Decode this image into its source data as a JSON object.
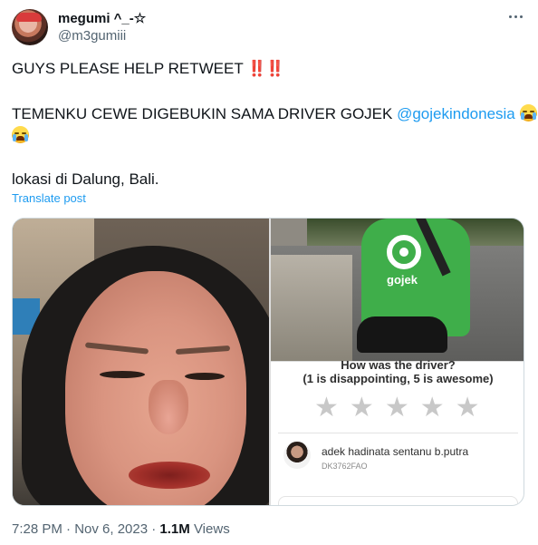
{
  "author": {
    "display_name": "megumi ^_-☆",
    "handle": "@m3gumiii"
  },
  "post": {
    "line1_text": "GUYS PLEASE HELP RETWEET",
    "line1_marks": "‼️‼️",
    "line2_text": "TEMENKU CEWE DIGEBUKIN SAMA DRIVER GOJEK ",
    "mention": "@gojekindonesia",
    "emoji_name": "loudly-crying-face-emoji",
    "line3_text": "lokasi di Dalung, Bali.",
    "translate_label": "Translate post"
  },
  "media": {
    "driver_photo_logo_text": "gojek",
    "rating_panel": {
      "question": "How was the driver?",
      "hint": "(1 is disappointing, 5 is awesome)",
      "stars": [
        "★",
        "★",
        "★",
        "★",
        "★"
      ],
      "star_rating": 0,
      "driver_name": "adek hadinata sentanu b.putra",
      "driver_plate": "DK3762FAO"
    }
  },
  "meta": {
    "timestamp": "7:28 PM · Nov 6, 2023 · ",
    "views_count": "1.1M",
    "views_label": " Views"
  },
  "colors": {
    "link": "#1d9bf0",
    "text": "#0f1419",
    "muted": "#536471",
    "gojek_green": "#3fae4a"
  },
  "icons": {
    "more": "more-horizontal-icon"
  }
}
